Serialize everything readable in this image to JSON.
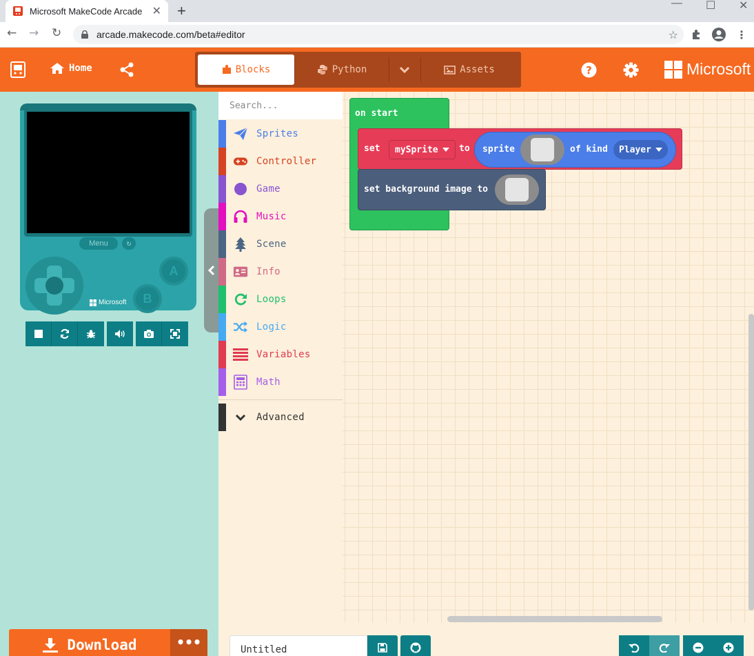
{
  "browser": {
    "tab_title": "Microsoft MakeCode Arcade",
    "url": "arcade.makecode.com/beta#editor"
  },
  "header": {
    "home_label": "Home",
    "modes": {
      "blocks": "Blocks",
      "python": "Python",
      "assets": "Assets"
    },
    "brand": "Microsoft"
  },
  "simulator": {
    "menu_label": "Menu",
    "button_a": "A",
    "button_b": "B",
    "brand": "Microsoft"
  },
  "toolbox": {
    "search_placeholder": "Search...",
    "categories": [
      {
        "label": "Sprites",
        "color": "#4b7ee8",
        "icon": "paper-plane-icon"
      },
      {
        "label": "Controller",
        "color": "#d54322",
        "icon": "gamepad-icon"
      },
      {
        "label": "Game",
        "color": "#8854d0",
        "icon": "circle-icon"
      },
      {
        "label": "Music",
        "color": "#e30fc0",
        "icon": "headphones-icon"
      },
      {
        "label": "Scene",
        "color": "#4b6584",
        "icon": "tree-icon"
      },
      {
        "label": "Info",
        "color": "#cf6a87",
        "icon": "id-card-icon"
      },
      {
        "label": "Loops",
        "color": "#20bf6b",
        "icon": "loop-arrow-icon"
      },
      {
        "label": "Logic",
        "color": "#45aaf2",
        "icon": "shuffle-icon"
      },
      {
        "label": "Variables",
        "color": "#e03b50",
        "icon": "list-icon"
      },
      {
        "label": "Math",
        "color": "#a55eea",
        "icon": "calculator-icon"
      }
    ],
    "advanced_label": "Advanced"
  },
  "workspace": {
    "on_start": "on start",
    "set_kw": "set",
    "variable": "mySprite",
    "to_kw": "to",
    "sprite_kw": "sprite",
    "of_kind_kw": "of kind",
    "kind": "Player",
    "set_bg": "set background image to"
  },
  "footer": {
    "download_label": "Download",
    "project_name": "Untitled"
  },
  "colors": {
    "brand_orange": "#f66920",
    "sim_bg": "#b3e3d8",
    "teal": "#0d7e86"
  }
}
